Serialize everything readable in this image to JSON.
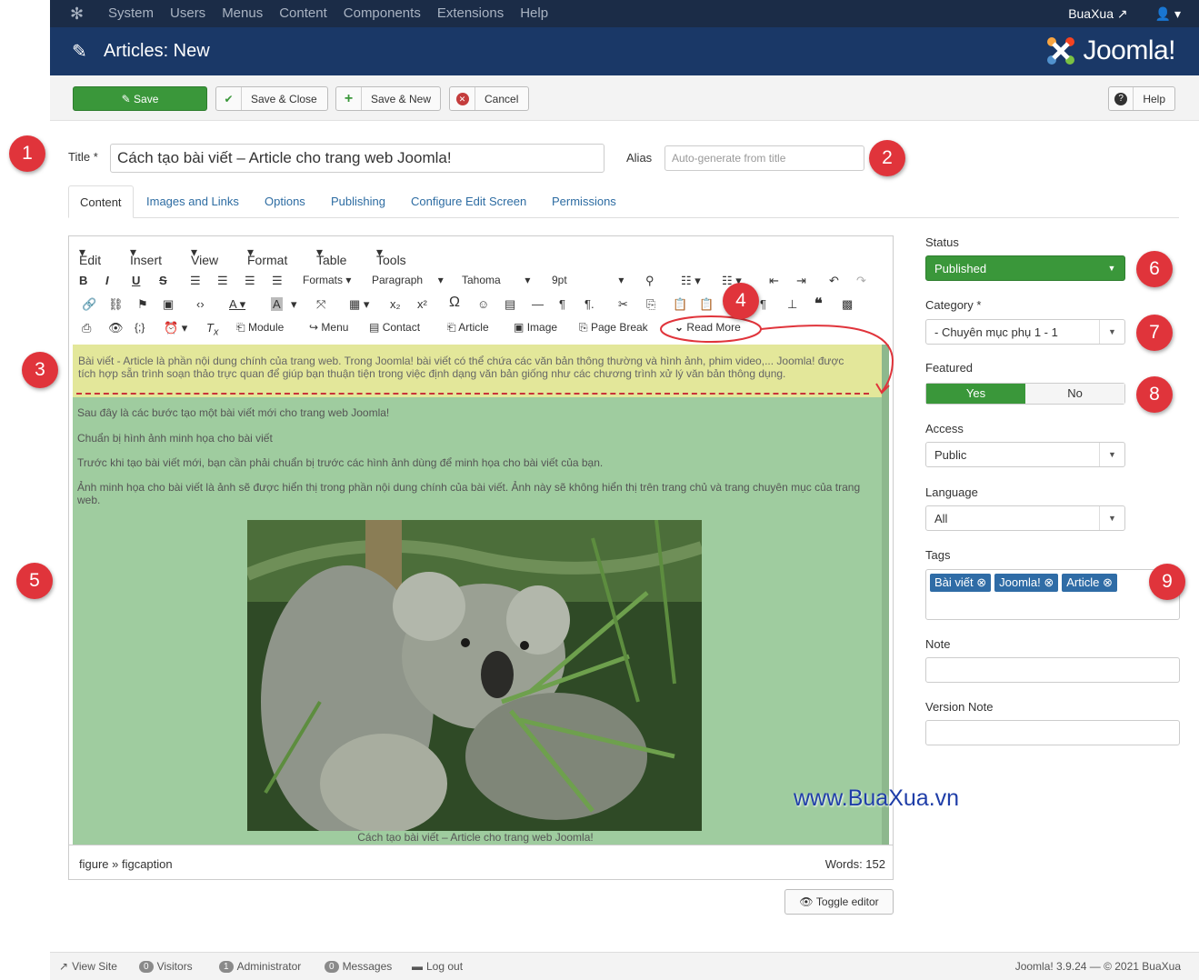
{
  "topnav": {
    "items": [
      "System",
      "Users",
      "Menus",
      "Content",
      "Components",
      "Extensions",
      "Help"
    ],
    "site_link": "BuaXua",
    "user_icon": "user-icon"
  },
  "header": {
    "title": "Articles: New",
    "brand": "Joomla!"
  },
  "toolbar": {
    "save": "Save",
    "save_close": "Save & Close",
    "save_new": "Save & New",
    "cancel": "Cancel",
    "help": "Help"
  },
  "form": {
    "title_label": "Title *",
    "title_value": "Cách tạo bài viết – Article cho trang web Joomla!",
    "alias_label": "Alias",
    "alias_placeholder": "Auto-generate from title"
  },
  "tabs": [
    "Content",
    "Images and Links",
    "Options",
    "Publishing",
    "Configure Edit Screen",
    "Permissions"
  ],
  "editor": {
    "menubar": [
      "Edit",
      "Insert",
      "View",
      "Format",
      "Table",
      "Tools"
    ],
    "formats": "Formats",
    "paragraph": "Paragraph",
    "font": "Tahoma",
    "size": "9pt",
    "buttons": {
      "module": "Module",
      "menu": "Menu",
      "contact": "Contact",
      "article": "Article",
      "image": "Image",
      "page_break": "Page Break",
      "read_more": "Read More"
    },
    "intro": "Bài viết - Article là phần nội dung chính của trang web. Trong Joomla! bài viết có thể chứa các văn bản thông thường và hình ảnh, phim video,... Joomla! được tích hợp sẵn trình soạn thảo trực quan để giúp bạn thuận tiện trong việc định dạng văn bản giống như các chương trình xử lý văn bản thông dụng.",
    "paragraphs": [
      "Sau đây là các bước tạo một bài viết mới cho trang web Joomla!",
      "Chuẩn bị hình ảnh minh họa cho bài viết",
      "Trước khi tạo bài viết mới, bạn cần phải chuẩn bị trước các hình ảnh dùng để minh họa cho bài viết của bạn.",
      "Ảnh minh họa cho bài viết là ảnh sẽ được hiển thị trong phần nội dung chính của bài viết. Ảnh này sẽ không hiển thị trên trang chủ và trang chuyên mục của trang web."
    ],
    "caption": "Cách tạo bài viết – Article cho trang web Joomla!",
    "path": "figure » figcaption",
    "words": "Words: 152",
    "toggle": "Toggle editor"
  },
  "sidebar": {
    "status_label": "Status",
    "status_value": "Published",
    "category_label": "Category *",
    "category_value": "- Chuyên mục phụ 1 - 1",
    "featured_label": "Featured",
    "featured_yes": "Yes",
    "featured_no": "No",
    "access_label": "Access",
    "access_value": "Public",
    "language_label": "Language",
    "language_value": "All",
    "tags_label": "Tags",
    "tags": [
      "Bài viết",
      "Joomla!",
      "Article"
    ],
    "note_label": "Note",
    "version_note_label": "Version Note"
  },
  "markers": [
    "1",
    "2",
    "3",
    "4",
    "5",
    "6",
    "7",
    "8",
    "9"
  ],
  "watermark": "www.BuaXua.vn",
  "footer": {
    "view_site": "View Site",
    "visitors_count": "0",
    "visitors": "Visitors",
    "admin_count": "1",
    "admin": "Administrator",
    "messages_count": "0",
    "messages": "Messages",
    "logout": "Log out",
    "version": "Joomla! 3.9.24 — © 2021 BuaXua"
  },
  "colors": {
    "nav": "#1b2c47",
    "header": "#1a3867",
    "save_green": "#3a973a",
    "marker_red": "#e0343b",
    "tag_blue": "#2f6ca6"
  }
}
